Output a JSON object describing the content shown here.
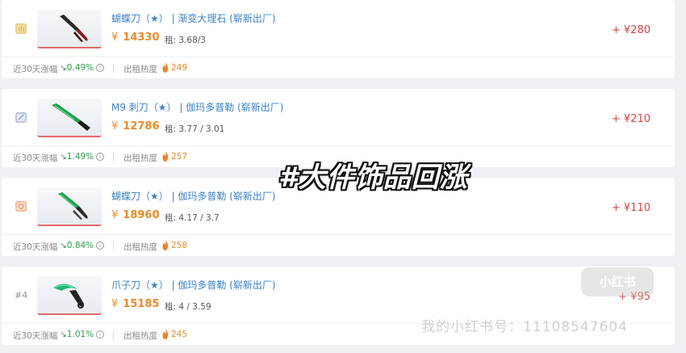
{
  "items": [
    {
      "rank": "",
      "rank_icon": "gold-badge-icon",
      "rank_color": "#e0b84a",
      "thumb_icon": "butterfly-knife-fade-icon",
      "name": "蝴蝶刀（★） | 渐变大理石 (崭新出厂)",
      "currency": "¥",
      "price": "14330",
      "rent": "租: 3.68/3",
      "delta": "+ ¥280",
      "trend_label": "近30天涨幅",
      "trend": "↘0.49%",
      "info": "i",
      "heat_label": "出租热度",
      "heat": "249"
    },
    {
      "rank": "",
      "rank_icon": "silver-badge-icon",
      "rank_color": "#9aa7c9",
      "thumb_icon": "m9-bayonet-gamma-doppler-icon",
      "name": "M9 刺刀（★） | 伽玛多普勒 (崭新出厂)",
      "currency": "¥",
      "price": "12786",
      "rent": "租: 3.77 / 3.01",
      "delta": "+ ¥210",
      "trend_label": "近30天涨幅",
      "trend": "↘1.49%",
      "info": "i",
      "heat_label": "出租热度",
      "heat": "257"
    },
    {
      "rank": "",
      "rank_icon": "bronze-badge-icon",
      "rank_color": "#e59a6a",
      "thumb_icon": "butterfly-knife-gamma-doppler-icon",
      "name": "蝴蝶刀（★） | 伽玛多普勒 (崭新出厂)",
      "currency": "¥",
      "price": "18960",
      "rent": "租: 4.17 / 3.7",
      "delta": "+ ¥110",
      "trend_label": "近30天涨幅",
      "trend": "↘0.84%",
      "info": "i",
      "heat_label": "出租热度",
      "heat": "258"
    },
    {
      "rank": "#4",
      "rank_icon": "",
      "rank_color": "#999999",
      "thumb_icon": "karambit-gamma-doppler-icon",
      "name": "爪子刀（★） | 伽玛多普勒 (崭新出厂)",
      "currency": "¥",
      "price": "15185",
      "rent": "租: 4 / 3.59",
      "delta": "+ ¥95",
      "trend_label": "近30天涨幅",
      "trend": "↘1.01%",
      "info": "i",
      "heat_label": "出租热度",
      "heat": "245"
    }
  ],
  "overlay_text": "#大件饰品回涨",
  "watermark_logo": "小红书",
  "watermark_id": "我的小红书号：11108547604"
}
